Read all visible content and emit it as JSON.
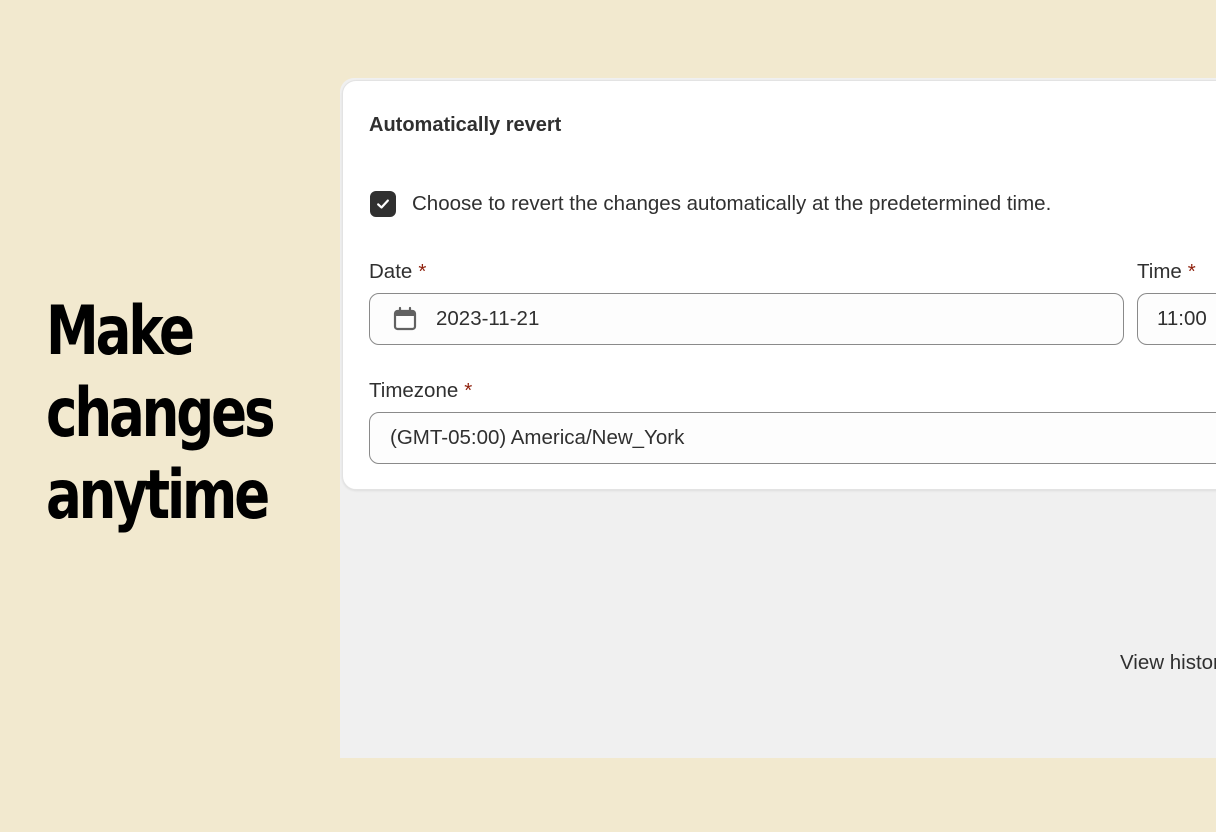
{
  "headline": {
    "line1": "Make",
    "line2": "changes",
    "line3": "anytime"
  },
  "card": {
    "title": "Automatically revert",
    "checkbox_label": "Choose to revert the changes automatically at the predetermined time.",
    "checkbox_checked": true,
    "date_label": "Date",
    "date_value": "2023-11-21",
    "time_label": "Time",
    "time_value": "11:00",
    "timezone_label": "Timezone",
    "timezone_value": "(GMT-05:00) America/New_York",
    "required_marker": "*"
  },
  "footer": {
    "view_history": "View history"
  },
  "colors": {
    "background": "#f2e9cf",
    "screen": "#f0f0f0",
    "card": "#ffffff",
    "text": "#303030",
    "required": "#8e1f0b",
    "checkbox": "#303030"
  },
  "icons": {
    "checkbox": "checkmark-icon",
    "date": "calendar-icon"
  }
}
